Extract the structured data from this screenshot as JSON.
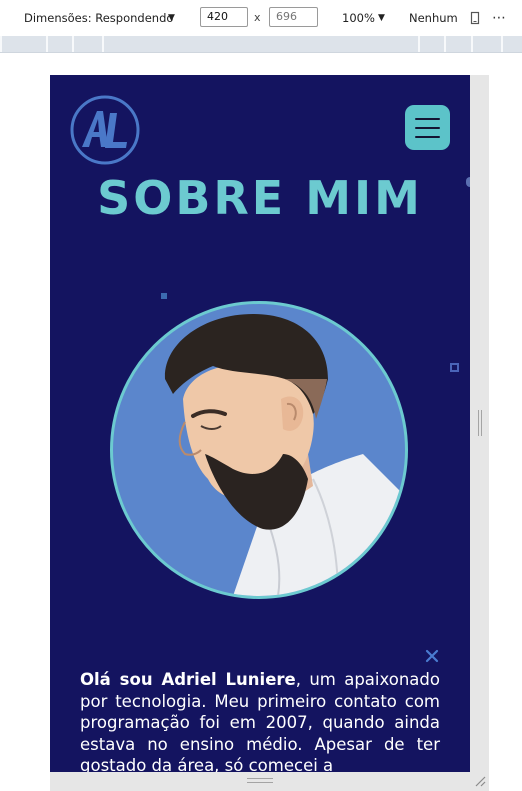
{
  "devtools": {
    "dimensions_label": "Dimensões: Respondendo",
    "width_value": "420",
    "height_placeholder": "696",
    "times_symbol": "x",
    "zoom_value": "100%",
    "throttle_value": "Nenhum",
    "more_label": "⋯"
  },
  "header": {
    "logo_text": "AL",
    "menu_icon": "hamburger-menu-icon"
  },
  "page": {
    "title": "SOBRE MIM",
    "bio_name": "Olá sou Adriel Luniere",
    "bio_text": ", um apaixonado por tecnologia. Meu primeiro contato com programação foi em 2007, quando ainda estava no ensino médio. Apesar de ter gostado da área, só comecei a"
  },
  "colors": {
    "page_background": "#141460",
    "accent": "#6ccad0",
    "menu_button": "#5cc3c9",
    "portrait_background": "#5b86cc",
    "logo_blue": "#4a78c8"
  }
}
